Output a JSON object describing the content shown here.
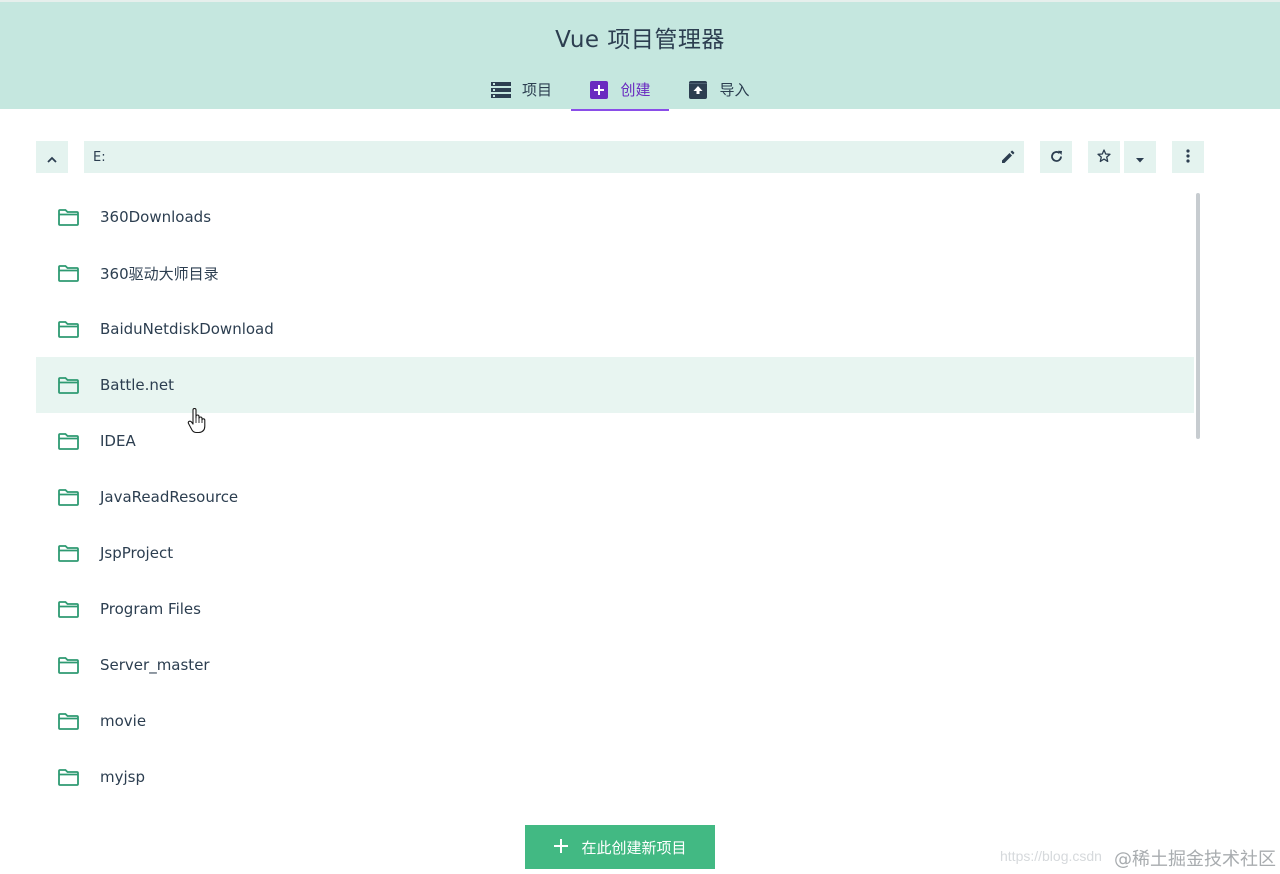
{
  "header": {
    "title": "Vue 项目管理器",
    "tabs": [
      {
        "label": "项目",
        "icon": "list-icon"
      },
      {
        "label": "创建",
        "icon": "add-box-icon",
        "active": true
      },
      {
        "label": "导入",
        "icon": "unarchive-icon"
      }
    ]
  },
  "toolbar": {
    "path": "E:",
    "up_icon": "chevron-up-icon",
    "edit_icon": "pencil-icon",
    "refresh_icon": "refresh-icon",
    "favorite_icon": "star-outline-icon",
    "favorite_menu_icon": "caret-down-icon",
    "more_icon": "more-vert-icon"
  },
  "folders": [
    "360Downloads",
    "360驱动大师目录",
    "BaiduNetdiskDownload",
    "Battle.net",
    "IDEA",
    "JavaReadResource",
    "JspProject",
    "Program Files",
    "Server_master",
    "movie",
    "myjsp"
  ],
  "hovered_folder": "Battle.net",
  "create_button": {
    "label": "在此创建新项目",
    "icon": "plus-icon"
  },
  "watermark": {
    "url": "https://blog.csdn",
    "text": "@稀土掘金技术社区"
  },
  "colors": {
    "header_bg": "#c5e7df",
    "accent_green": "#42b983",
    "active_tab": "#6a2bc0",
    "folder_icon": "#2e9a72",
    "toolbar_bg": "#e4f3ef"
  }
}
